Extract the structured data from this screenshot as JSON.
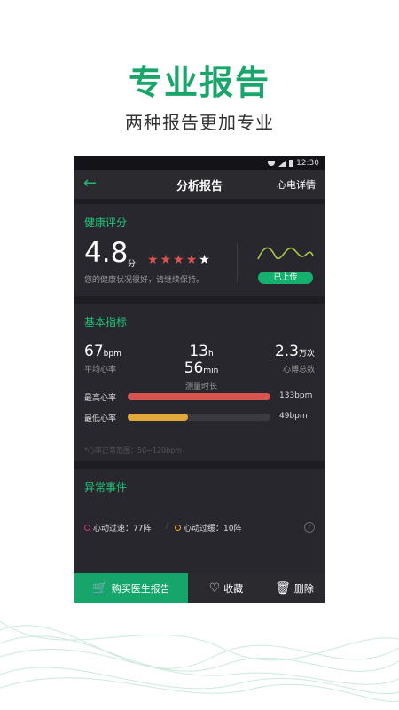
{
  "promo": {
    "title": "专业报告",
    "subtitle": "两种报告更加专业"
  },
  "status_bar": {
    "time": "12:30"
  },
  "app_bar": {
    "title": "分析报告",
    "right_link": "心电详情"
  },
  "health": {
    "section_title": "健康评分",
    "score": "4.8",
    "score_unit": "分",
    "stars": {
      "filled": 4,
      "total": 5,
      "filled_color": "#d9534f"
    },
    "note": "您的健康状况很好，请继续保持。",
    "uploaded_label": "已上传"
  },
  "basic": {
    "section_title": "基本指标",
    "metrics": [
      {
        "value": "67",
        "unit": "bpm",
        "label": "平均心率"
      },
      {
        "value_h": "13",
        "unit_h": "h",
        "value_m": "56",
        "unit_m": "min",
        "label": "测量时长"
      },
      {
        "value": "2.3",
        "unit": "万次",
        "label": "心博总数"
      }
    ],
    "bars": [
      {
        "label": "最高心率",
        "value": "133bpm",
        "fill": 1.0,
        "color": "#d9534f"
      },
      {
        "label": "最低心率",
        "value": "49bpm",
        "fill": 0.42,
        "color": "#e1a93a"
      }
    ],
    "range_note": "*心率正常范围：50~120bpm"
  },
  "abnormal": {
    "section_title": "异常事件",
    "tachy": "心动过速：77阵",
    "brady": "心动过缓：10阵",
    "help_icon": "?"
  },
  "bottom": {
    "buy_label": "购买医生报告",
    "fav_label": "收藏",
    "delete_label": "删除"
  },
  "colors": {
    "accent": "#1fc67a",
    "button_green": "#16a56a",
    "panel": "#28272d"
  }
}
